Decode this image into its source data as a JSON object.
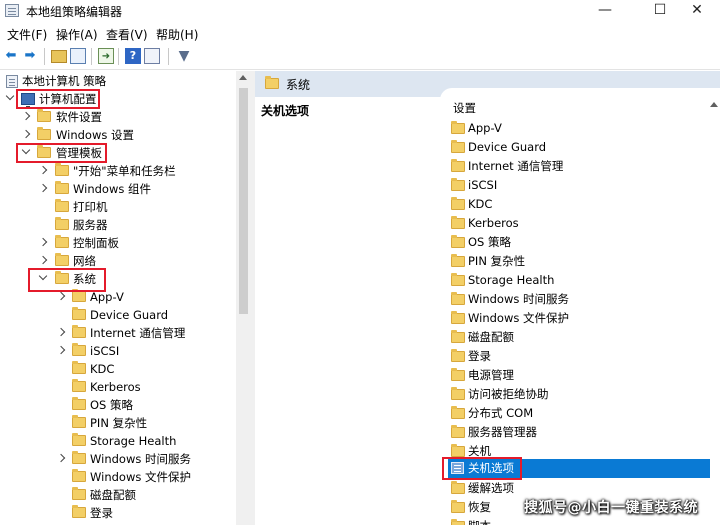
{
  "window": {
    "title": "本地组策略编辑器",
    "controls": {
      "minimize": "—",
      "maximize": "☐",
      "close": "✕"
    }
  },
  "menu": [
    "文件(F)",
    "操作(A)",
    "查看(V)",
    "帮助(H)"
  ],
  "toolbar": {
    "icons": [
      "back-arrow-icon",
      "forward-arrow-icon",
      "up-folder-icon",
      "show-hide-tree-icon",
      "export-list-icon",
      "help-icon",
      "properties-icon",
      "filter-icon"
    ]
  },
  "tree": {
    "root": "本地计算机 策略",
    "computer_config": "计算机配置",
    "software_settings": "软件设置",
    "windows_settings": "Windows 设置",
    "admin_templates": "管理模板",
    "start_menu": "\"开始\"菜单和任务栏",
    "windows_components": "Windows 组件",
    "printers": "打印机",
    "server": "服务器",
    "control_panel": "控制面板",
    "network": "网络",
    "system": "系统",
    "system_children": [
      "App-V",
      "Device Guard",
      "Internet 通信管理",
      "iSCSI",
      "KDC",
      "Kerberos",
      "OS 策略",
      "PIN 复杂性",
      "Storage Health",
      "Windows 时间服务",
      "Windows 文件保护",
      "磁盘配额",
      "登录"
    ]
  },
  "right": {
    "header": "系统",
    "description_title": "关机选项",
    "column_header": "设置",
    "items": [
      "App-V",
      "Device Guard",
      "Internet 通信管理",
      "iSCSI",
      "KDC",
      "Kerberos",
      "OS 策略",
      "PIN 复杂性",
      "Storage Health",
      "Windows 时间服务",
      "Windows 文件保护",
      "磁盘配额",
      "登录",
      "电源管理",
      "访问被拒绝协助",
      "分布式 COM",
      "服务器管理器",
      "关机",
      "关机选项",
      "缓解选项",
      "恢复",
      "脚本"
    ],
    "selected_item": "关机选项"
  },
  "watermark": "搜狐号@小白一键重装系统",
  "colors": {
    "highlight_box": "#e41b2b",
    "selection": "#0a7ad4",
    "header_bg": "#dde6f1"
  }
}
